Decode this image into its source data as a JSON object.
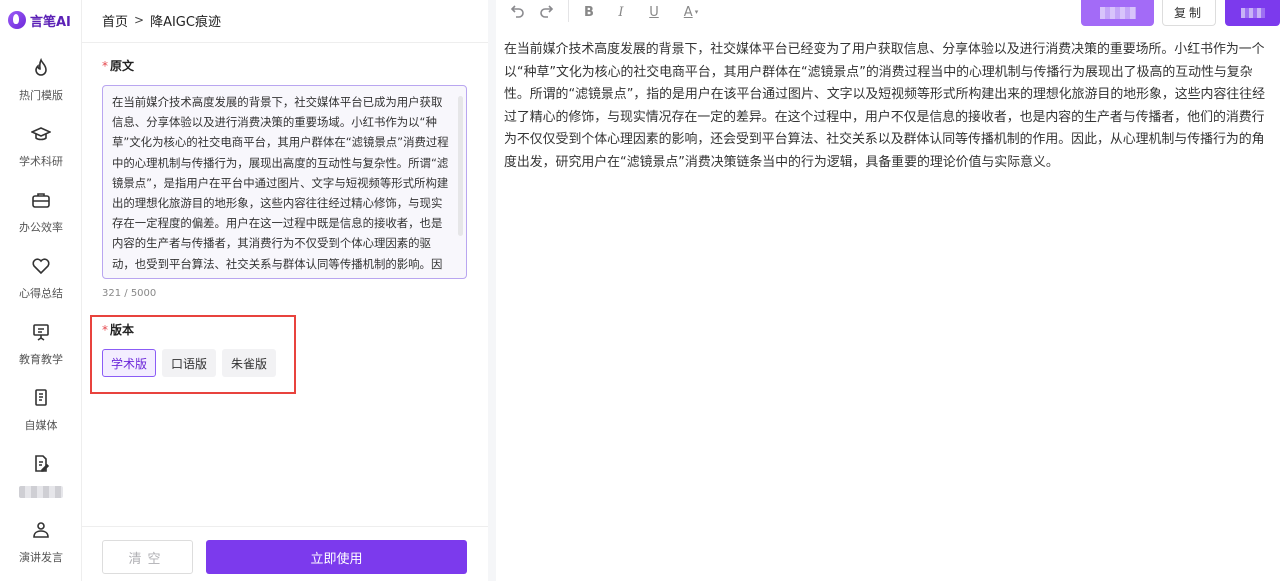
{
  "brand": {
    "name": "言笔AI"
  },
  "sidebar": {
    "items": [
      {
        "label": "热门模版",
        "icon": "flame-icon"
      },
      {
        "label": "学术科研",
        "icon": "graduation-cap-icon"
      },
      {
        "label": "办公效率",
        "icon": "briefcase-icon"
      },
      {
        "label": "心得总结",
        "icon": "heart-icon"
      },
      {
        "label": "教育教学",
        "icon": "presentation-icon"
      },
      {
        "label": "自媒体",
        "icon": "document-icon"
      },
      {
        "label": "",
        "icon": "pen-document-icon"
      },
      {
        "label": "演讲发言",
        "icon": "speaker-icon"
      }
    ]
  },
  "breadcrumb": {
    "home": "首页",
    "separator": ">",
    "current": "降AIGC痕迹"
  },
  "form": {
    "source_label": "原文",
    "source_text": "在当前媒介技术高度发展的背景下，社交媒体平台已成为用户获取信息、分享体验以及进行消费决策的重要场域。小红书作为以“种草”文化为核心的社交电商平台，其用户群体在“滤镜景点”消费过程中的心理机制与传播行为，展现出高度的互动性与复杂性。所谓“滤镜景点”，是指用户在平台中通过图片、文字与短视频等形式所构建出的理想化旅游目的地形象，这些内容往往经过精心修饰，与现实存在一定程度的偏差。用户在这一过程中既是信息的接收者，也是内容的生产者与传播者，其消费行为不仅受到个体心理因素的驱动，也受到平台算法、社交关系与群体认同等传播机制的影响。因此，从心理机制与传播行为的角度切入，",
    "char_count": "321 / 5000",
    "version_label": "版本",
    "versions": [
      "学术版",
      "口语版",
      "朱雀版"
    ],
    "selected_version": "学术版",
    "clear_label": "清空",
    "submit_label": "立即使用"
  },
  "toolbar": {
    "undo_icon": "undo-icon",
    "redo_icon": "redo-icon",
    "bold": "B",
    "italic": "I",
    "underline": "U",
    "font_color": "A",
    "copy_label": "复制"
  },
  "editor": {
    "content": "在当前媒介技术高度发展的背景下，社交媒体平台已经变为了用户获取信息、分享体验以及进行消费决策的重要场所。小红书作为一个以“种草”文化为核心的社交电商平台，其用户群体在“滤镜景点”的消费过程当中的心理机制与传播行为展现出了极高的互动性与复杂性。所谓的“滤镜景点”，指的是用户在该平台通过图片、文字以及短视频等形式所构建出来的理想化旅游目的地形象，这些内容往往经过了精心的修饰，与现实情况存在一定的差异。在这个过程中，用户不仅是信息的接收者，也是内容的生产者与传播者，他们的消费行为不仅仅受到个体心理因素的影响，还会受到平台算法、社交关系以及群体认同等传播机制的作用。因此，从心理机制与传播行为的角度出发，研究用户在“滤镜景点”消费决策链条当中的行为逻辑，具备重要的理论价值与实际意义。"
  },
  "colors": {
    "accent": "#7c3aed",
    "highlight_box": "#e8433d"
  }
}
